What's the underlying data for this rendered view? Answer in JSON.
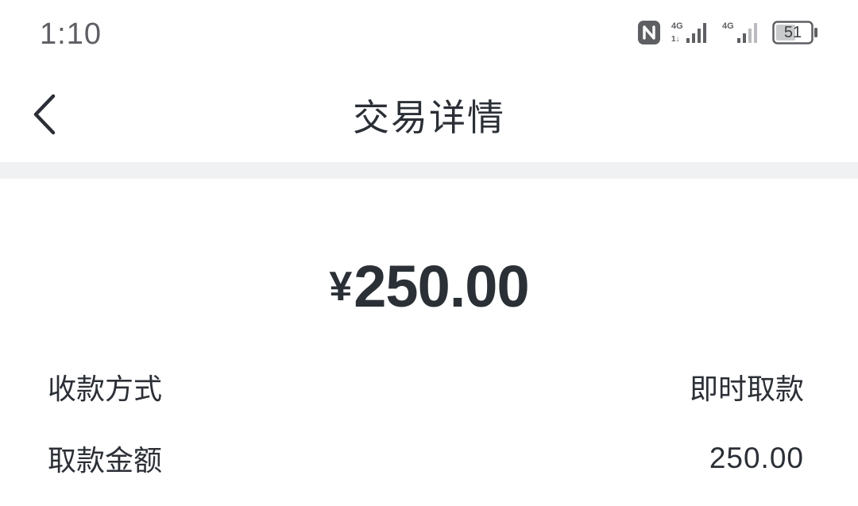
{
  "status_bar": {
    "time": "1:10",
    "battery_level": "51",
    "network_1": "4G",
    "network_2": "4G",
    "icons": [
      "nfc-icon",
      "signal-4g-icon",
      "signal-4g-icon",
      "battery-icon"
    ]
  },
  "nav": {
    "back_icon": "chevron-left-icon",
    "title": "交易详情"
  },
  "summary": {
    "currency_symbol": "¥",
    "amount": "250.00"
  },
  "details": [
    {
      "label": "收款方式",
      "value": "即时取款"
    },
    {
      "label": "取款金额",
      "value": "250.00"
    }
  ],
  "colors": {
    "text_primary": "#2b2f36",
    "divider": "#f0f1f3",
    "background": "#ffffff"
  }
}
